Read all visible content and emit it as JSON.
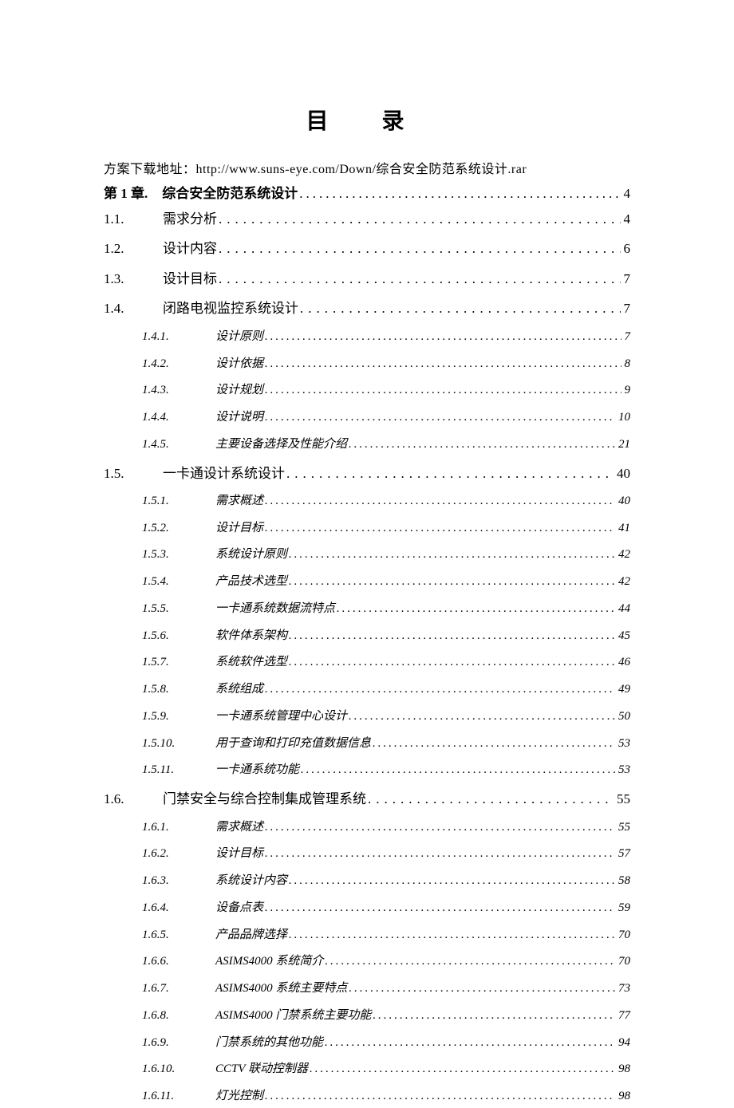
{
  "title": "目 录",
  "download": "方案下载地址：http://www.suns-eye.com/Down/综合安全防范系统设计.rar",
  "toc": [
    {
      "level": "chapter",
      "num": "第 1 章.",
      "label": "综合安全防范系统设计",
      "page": "4"
    },
    {
      "level": "sec",
      "num": "1.1.",
      "label": "需求分析",
      "page": "4"
    },
    {
      "level": "sec",
      "num": "1.2.",
      "label": "设计内容",
      "page": "6"
    },
    {
      "level": "sec",
      "num": "1.3.",
      "label": "设计目标",
      "page": "7"
    },
    {
      "level": "sec",
      "num": "1.4.",
      "label": "闭路电视监控系统设计",
      "page": "7"
    },
    {
      "level": "sub",
      "num": "1.4.1.",
      "label": "设计原则",
      "page": "7"
    },
    {
      "level": "sub",
      "num": "1.4.2.",
      "label": "设计依据",
      "page": "8"
    },
    {
      "level": "sub",
      "num": "1.4.3.",
      "label": "设计规划",
      "page": "9"
    },
    {
      "level": "sub",
      "num": "1.4.4.",
      "label": "设计说明",
      "page": "10"
    },
    {
      "level": "sub",
      "num": "1.4.5.",
      "label": "主要设备选择及性能介绍",
      "page": "21"
    },
    {
      "level": "sec",
      "num": "1.5.",
      "label": "一卡通设计系统设计",
      "page": "40"
    },
    {
      "level": "sub",
      "num": "1.5.1.",
      "label": "需求概述",
      "page": "40"
    },
    {
      "level": "sub",
      "num": "1.5.2.",
      "label": "设计目标",
      "page": "41"
    },
    {
      "level": "sub",
      "num": "1.5.3.",
      "label": "系统设计原则",
      "page": "42"
    },
    {
      "level": "sub",
      "num": "1.5.4.",
      "label": "产品技术选型",
      "page": "42"
    },
    {
      "level": "sub",
      "num": "1.5.5.",
      "label": "一卡通系统数据流特点",
      "page": "44"
    },
    {
      "level": "sub",
      "num": "1.5.6.",
      "label": "软件体系架构",
      "page": "45"
    },
    {
      "level": "sub",
      "num": "1.5.7.",
      "label": "系统软件选型",
      "page": "46"
    },
    {
      "level": "sub",
      "num": "1.5.8.",
      "label": "系统组成",
      "page": "49"
    },
    {
      "level": "sub",
      "num": "1.5.9.",
      "label": "一卡通系统管理中心设计",
      "page": "50"
    },
    {
      "level": "sub",
      "num": "1.5.10.",
      "label": "用于查询和打印充值数据信息",
      "page": "53"
    },
    {
      "level": "sub",
      "num": "1.5.11.",
      "label": "一卡通系统功能",
      "page": "53"
    },
    {
      "level": "sec",
      "num": "1.6.",
      "label": "门禁安全与综合控制集成管理系统",
      "page": "55"
    },
    {
      "level": "sub",
      "num": "1.6.1.",
      "label": "需求概述",
      "page": "55"
    },
    {
      "level": "sub",
      "num": "1.6.2.",
      "label": "设计目标",
      "page": "57"
    },
    {
      "level": "sub",
      "num": "1.6.3.",
      "label": "系统设计内容",
      "page": "58"
    },
    {
      "level": "sub",
      "num": "1.6.4.",
      "label": "设备点表",
      "page": "59"
    },
    {
      "level": "sub",
      "num": "1.6.5.",
      "label": "产品品牌选择",
      "page": "70"
    },
    {
      "level": "sub",
      "num": "1.6.6.",
      "label": "ASIMS4000 系统简介",
      "page": "70"
    },
    {
      "level": "sub",
      "num": "1.6.7.",
      "label": "ASIMS4000 系统主要特点",
      "page": "73"
    },
    {
      "level": "sub",
      "num": "1.6.8.",
      "label": "ASIMS4000 门禁系统主要功能",
      "page": "77"
    },
    {
      "level": "sub",
      "num": "1.6.9.",
      "label": "门禁系统的其他功能",
      "page": "94"
    },
    {
      "level": "sub",
      "num": "1.6.10.",
      "label": "CCTV 联动控制器",
      "page": "98"
    },
    {
      "level": "sub",
      "num": "1.6.11.",
      "label": "灯光控制",
      "page": "98"
    }
  ]
}
